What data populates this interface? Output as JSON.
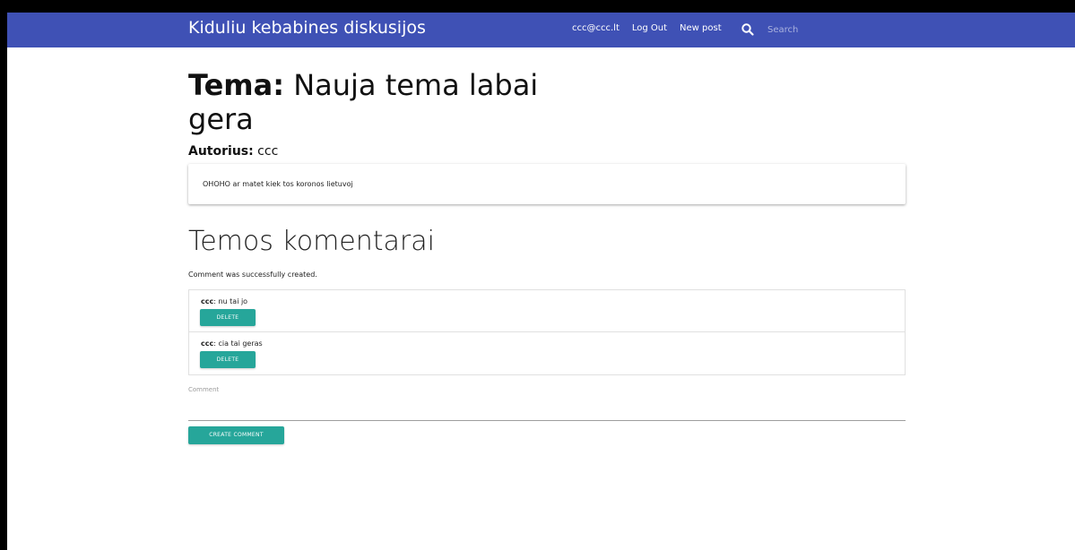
{
  "navbar": {
    "brand": "Kiduliu kebabines diskusijos",
    "links": [
      "ccc@ccc.lt",
      "Log Out",
      "New post"
    ],
    "search": {
      "placeholder": "Search",
      "value": ""
    },
    "color": "#3f51b5"
  },
  "topic": {
    "label": "Tema:",
    "title": "Nauja tema labai gera",
    "author_label": "Autorius:",
    "author": "ccc",
    "body": "OHOHO ar matet kiek tos koronos lietuvoj"
  },
  "comments_section": {
    "heading": "Temos komentarai",
    "notice": "Comment was successfully created.",
    "items": [
      {
        "author": "ccc",
        "text": ": nu tai jo",
        "delete_label": "DELETE"
      },
      {
        "author": "ccc",
        "text": ": cia tai geras",
        "delete_label": "DELETE"
      }
    ],
    "field_label": "Comment",
    "field_value": "",
    "submit_label": "CREATE COMMENT",
    "button_color": "#26a69a"
  }
}
